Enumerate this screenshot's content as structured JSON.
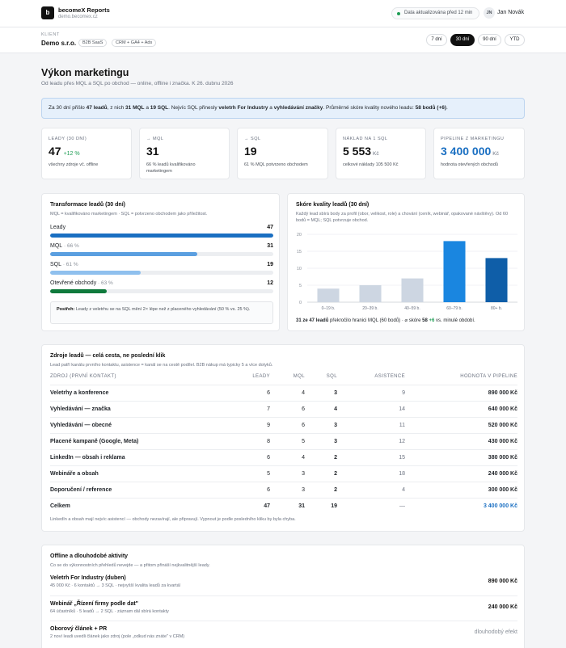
{
  "header": {
    "logo_letter": "b",
    "app_name": "becomeX Reports",
    "domain": "demo.becomex.cz",
    "status": "Data aktualizována před 12 min",
    "user_initials": "JN",
    "user_name": "Jan Novák"
  },
  "client": {
    "label": "KLIENT",
    "name": "Demo s.r.o.",
    "tags": [
      "B2B SaaS",
      "CRM + GA4 + Ads"
    ],
    "ranges": [
      "7 dní",
      "30 dní",
      "90 dní",
      "YTD"
    ],
    "active_range": "30 dní"
  },
  "page": {
    "title": "Výkon marketingu",
    "subtitle": "Od leadu přes MQL a SQL po obchod — online, offline i značka. K 26. dubnu 2026"
  },
  "summary": {
    "p1": "Za 30 dní přišlo ",
    "leads": "47 leadů",
    "p2": ", z nich ",
    "mql": "31 MQL",
    "p3": " a ",
    "sql": "19 SQL",
    "p4": ". Nejvíc SQL přinesly ",
    "src1": "veletrh For Industry",
    "p5": " a ",
    "src2": "vyhledávání značky",
    "p6": ". Průměrné skóre kvality nového leadu: ",
    "score": "58 bodů (+6)",
    "p7": "."
  },
  "kpis": [
    {
      "label": "LEADY (30 DNÍ)",
      "value": "47",
      "delta": "+12 %",
      "unit": "",
      "note": "všechny zdroje vč. offline"
    },
    {
      "label": "→ MQL",
      "value": "31",
      "delta": "",
      "unit": "",
      "note": "66 % leadů kvalifikováno marketingem"
    },
    {
      "label": "→ SQL",
      "value": "19",
      "delta": "",
      "unit": "",
      "note": "61 % MQL potvrzeno obchodem"
    },
    {
      "label": "NÁKLAD NA 1 SQL",
      "value": "5 553",
      "delta": "",
      "unit": "Kč",
      "note": "celkové náklady 105 500 Kč"
    },
    {
      "label": "PIPELINE Z MARKETINGU",
      "value": "3 400 000",
      "delta": "",
      "unit": "Kč",
      "note": "hodnota otevřených obchodů"
    }
  ],
  "funnel": {
    "title": "Transformace leadů (30 dní)",
    "subtitle": "MQL = kvalifikováno marketingem · SQL = potvrzeno obchodem jako příležitost.",
    "max": 47,
    "rows": [
      {
        "label": "Leady",
        "pct": "",
        "value": 47,
        "color": "#1a6fc2"
      },
      {
        "label": "MQL",
        "pct": " · 66 %",
        "value": 31,
        "color": "#5b9fe0"
      },
      {
        "label": "SQL",
        "pct": " · 61 %",
        "value": 19,
        "color": "#8fc0ee"
      },
      {
        "label": "Otevřené obchody",
        "pct": " · 63 %",
        "value": 12,
        "color": "#0f7a3c"
      }
    ],
    "insight_label": "Postřeh:",
    "insight_text": " Leady z veletrhu se na SQL mění 2× lépe než z placeného vyhledávání (50 % vs. 25 %)."
  },
  "chart_data": {
    "type": "bar",
    "title": "Skóre kvality leadů (30 dní)",
    "subtitle": "Každý lead sbírá body za profil (obor, velikost, role) a chování (ceník, webinář, opakované návštěvy). Od 60 bodů = MQL; SQL potvrzuje obchod.",
    "categories": [
      "0–19 b.",
      "20–39 b.",
      "40–59 b.",
      "60–79 b.",
      "80+ b."
    ],
    "values": [
      4,
      5,
      7,
      18,
      13
    ],
    "colors": [
      "#cdd6e2",
      "#cdd6e2",
      "#cdd6e2",
      "#1a86e0",
      "#0f5ea8"
    ],
    "ylim": [
      0,
      20
    ],
    "yticks": [
      0,
      5,
      10,
      15,
      20
    ],
    "grid": true,
    "foot_bold": "31 ze 47 leadů",
    "foot_text": " překročilo hranici MQL (60 bodů) · ⌀ skóre ",
    "foot_score": "58",
    "foot_delta": " +6",
    "foot_tail": " vs. minulé období."
  },
  "sources": {
    "title": "Zdroje leadů — celá cesta, ne poslední klik",
    "subtitle": "Lead patří kanálu prvního kontaktu, asistence = kanál se na cestě podílel. B2B nákup má typicky 5 a více dotyků.",
    "columns": [
      "ZDROJ (PRVNÍ KONTAKT)",
      "LEADY",
      "MQL",
      "SQL",
      "ASISTENCE",
      "HODNOTA V PIPELINE"
    ],
    "rows": [
      {
        "name": "Veletrhy a konference",
        "leads": "6",
        "mql": "4",
        "sql": "3",
        "assist": "9",
        "value": "890 000 Kč"
      },
      {
        "name": "Vyhledávání — značka",
        "leads": "7",
        "mql": "6",
        "sql": "4",
        "assist": "14",
        "value": "640 000 Kč"
      },
      {
        "name": "Vyhledávání — obecné",
        "leads": "9",
        "mql": "6",
        "sql": "3",
        "assist": "11",
        "value": "520 000 Kč"
      },
      {
        "name": "Placené kampaně (Google, Meta)",
        "leads": "8",
        "mql": "5",
        "sql": "3",
        "assist": "12",
        "value": "430 000 Kč"
      },
      {
        "name": "LinkedIn — obsah i reklama",
        "leads": "6",
        "mql": "4",
        "sql": "2",
        "assist": "15",
        "value": "380 000 Kč"
      },
      {
        "name": "Webináře a obsah",
        "leads": "5",
        "mql": "3",
        "sql": "2",
        "assist": "18",
        "value": "240 000 Kč"
      },
      {
        "name": "Doporučení / reference",
        "leads": "6",
        "mql": "3",
        "sql": "2",
        "assist": "4",
        "value": "300 000 Kč"
      }
    ],
    "total": {
      "name": "Celkem",
      "leads": "47",
      "mql": "31",
      "sql": "19",
      "assist": "—",
      "value": "3 400 000 Kč"
    },
    "note": "LinkedIn a obsah mají nejvíc asistencí — obchody nezavírají, ale připravují. Vypnout je podle posledního kliku by byla chyba."
  },
  "offline": {
    "title": "Offline a dlouhodobé aktivity",
    "subtitle": "Co se do výkonnostních přehledů nevejde — a přitom přináší nejkvalitnější leady.",
    "items": [
      {
        "name": "Veletrh For Industry (duben)",
        "sub": "45 000 Kč · 6 kontaktů → 3 SQL · nejvyšší kvalita leadů za kvartál",
        "value": "890 000 Kč",
        "muted": false
      },
      {
        "name": "Webinář „Řízení firmy podle dat\"",
        "sub": "64 účastníků · 5 leadů → 2 SQL · záznam dál sbírá kontakty",
        "value": "240 000 Kč",
        "muted": false
      },
      {
        "name": "Oborový článek + PR",
        "sub": "2 noví leadi uvedli článek jako zdroj (pole „odkud nás znáte\" v CRM)",
        "value": "dlouhodobý efekt",
        "muted": true
      }
    ]
  }
}
